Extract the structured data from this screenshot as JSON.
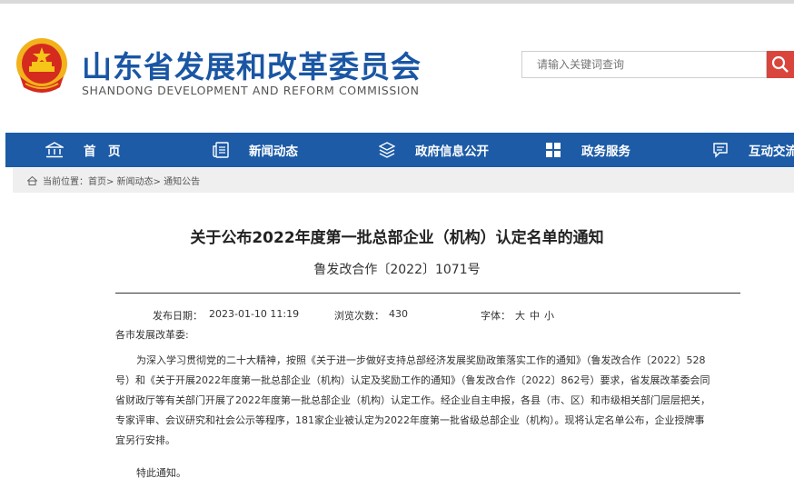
{
  "header": {
    "site_title": "山东省发展和改革委员会",
    "site_subtitle": "SHANDONG DEVELOPMENT AND REFORM COMMISSION",
    "search_placeholder": "请输入关键词查询"
  },
  "nav": {
    "items": [
      {
        "label": "首　页",
        "icon": "home-icon"
      },
      {
        "label": "新闻动态",
        "icon": "news-icon"
      },
      {
        "label": "政府信息公开",
        "icon": "layers-icon"
      },
      {
        "label": "政务服务",
        "icon": "grid-icon"
      },
      {
        "label": "互动交流",
        "icon": "chat-icon"
      }
    ]
  },
  "breadcrumb": {
    "prefix": "当前位置：",
    "path": "首页> 新闻动态> 通知公告"
  },
  "article": {
    "title": "关于公布2022年度第一批总部企业（机构）认定名单的通知",
    "doc_number": "鲁发改合作〔2022〕1071号",
    "publish_label": "发布日期：",
    "publish_date": "2023-01-10 11:19",
    "views_label": "浏览次数：",
    "views": "430",
    "font_label": "字体：",
    "font_large": "大",
    "font_medium": "中",
    "font_small": "小",
    "salutation": "各市发展改革委:",
    "body_lines": [
      "为深入学习贯彻党的二十大精神，按照《关于进一步做好支持总部经济发展奖励政策落实工作的通知》（鲁发改合作〔2022〕528",
      "号）和《关于开展2022年度第一批总部企业（机构）认定及奖励工作的通知》（鲁发改合作〔2022〕862号）要求，省发展改革委会同",
      "省财政厅等有关部门开展了2022年度第一批总部企业（机构）认定工作。经企业自主申报，各县（市、区）和市级相关部门层层把关，",
      "专家评审、会议研究和社会公示等程序，181家企业被认定为2022年度第一批省级总部企业（机构）。现将认定名单公布，企业授牌事",
      "宜另行安排。"
    ],
    "closing": "特此通知。"
  },
  "colors": {
    "brand_blue": "#1d5ba6",
    "title_blue": "#1a56a4",
    "search_red": "#d9453c"
  }
}
